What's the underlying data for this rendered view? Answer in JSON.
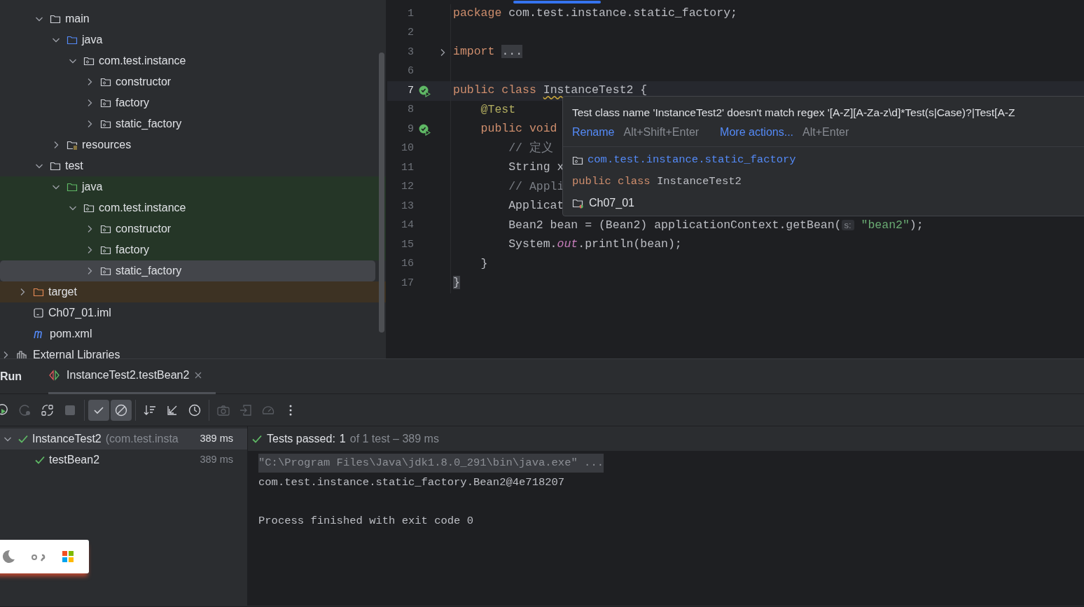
{
  "project_tree": [
    {
      "children": [
        {
          "children": [
            {
              "label": "main",
              "kind": "folder",
              "expanded": true,
              "selected": false,
              "children": [
                {
                  "label": "java",
                  "kind": "source-folder",
                  "expanded": true,
                  "selected": false,
                  "children": [
                    {
                      "label": "com.test.instance",
                      "kind": "package",
                      "expanded": true,
                      "selected": false,
                      "children": [
                        {
                          "label": "constructor",
                          "kind": "package",
                          "expanded": false,
                          "selected": false
                        },
                        {
                          "label": "factory",
                          "kind": "package",
                          "expanded": false,
                          "selected": false
                        },
                        {
                          "label": "static_factory",
                          "kind": "package",
                          "expanded": false,
                          "selected": false
                        }
                      ]
                    }
                  ]
                },
                {
                  "label": "resources",
                  "kind": "resources-folder",
                  "expanded": false,
                  "selected": false
                }
              ]
            },
            {
              "label": "test",
              "kind": "folder",
              "expanded": true,
              "selected": false,
              "children": [
                {
                  "label": "java",
                  "kind": "test-folder",
                  "expanded": true,
                  "selected": false,
                  "children": [
                    {
                      "label": "com.test.instance",
                      "kind": "package",
                      "expanded": true,
                      "selected": false,
                      "children": [
                        {
                          "label": "constructor",
                          "kind": "package",
                          "expanded": false,
                          "selected": false
                        },
                        {
                          "label": "factory",
                          "kind": "package",
                          "expanded": false,
                          "selected": false
                        },
                        {
                          "label": "static_factory",
                          "kind": "package",
                          "expanded": false,
                          "selected": true
                        }
                      ]
                    }
                  ]
                }
              ]
            }
          ]
        },
        {
          "label": "target",
          "kind": "excluded-folder",
          "expanded": false,
          "selected": false
        },
        {
          "label": "Ch07_01.iml",
          "kind": "module-file",
          "selected": false
        },
        {
          "label": "pom.xml",
          "kind": "maven-file",
          "selected": false
        }
      ]
    },
    {
      "label": "External Libraries",
      "kind": "library",
      "expanded": false,
      "selected": false
    }
  ],
  "editor": {
    "lines": [
      {
        "number": "1",
        "current": false,
        "runnable": false,
        "folded": false,
        "segments": [
          {
            "kind": "keyword",
            "text": "package"
          },
          {
            "kind": "plain",
            "text": " com.test.instance.static_factory;"
          }
        ]
      },
      {
        "number": "2",
        "current": false,
        "runnable": false,
        "folded": false
      },
      {
        "number": "3",
        "current": false,
        "runnable": false,
        "folded": true,
        "segments": [
          {
            "kind": "keyword",
            "text": "import"
          },
          {
            "kind": "fold",
            "text": "..."
          }
        ]
      },
      {
        "number": "6",
        "current": false,
        "runnable": false,
        "folded": false
      },
      {
        "number": "7",
        "current": true,
        "runnable": true,
        "folded": false,
        "segments": [
          {
            "kind": "keyword",
            "text": "public class "
          },
          {
            "kind": "warning",
            "text": "InstanceTest2"
          },
          {
            "kind": "plain",
            "text": " {"
          }
        ]
      },
      {
        "number": "8",
        "current": false,
        "runnable": false,
        "folded": false,
        "segments": [
          {
            "kind": "annotation",
            "text": "    @Test"
          }
        ]
      },
      {
        "number": "9",
        "current": false,
        "runnable": true,
        "folded": false,
        "segments": [
          {
            "kind": "keyword",
            "text": "    public void"
          }
        ]
      },
      {
        "number": "10",
        "current": false,
        "runnable": false,
        "folded": false,
        "segments": [
          {
            "kind": "comment",
            "text": "        // 定义"
          }
        ]
      },
      {
        "number": "11",
        "current": false,
        "runnable": false,
        "folded": false,
        "segments": [
          {
            "kind": "plain",
            "text": "        String x"
          }
        ]
      },
      {
        "number": "12",
        "current": false,
        "runnable": false,
        "folded": false,
        "segments": [
          {
            "kind": "comment",
            "text": "        // Appli"
          }
        ]
      },
      {
        "number": "13",
        "current": false,
        "runnable": false,
        "folded": false,
        "segments": [
          {
            "kind": "plain",
            "text": "        Applicat"
          }
        ]
      },
      {
        "number": "14",
        "current": false,
        "runnable": false,
        "folded": false,
        "segments": [
          {
            "kind": "plain",
            "text": "        Bean2 bean = (Bean2) applicationContext.getBean("
          },
          {
            "kind": "hint",
            "text": "s:"
          },
          {
            "kind": "string",
            "text": " \"bean2\""
          },
          {
            "kind": "plain",
            "text": ");"
          }
        ]
      },
      {
        "number": "15",
        "current": false,
        "runnable": false,
        "folded": false,
        "segments": [
          {
            "kind": "plain",
            "text": "        System."
          },
          {
            "kind": "field",
            "text": "out"
          },
          {
            "kind": "plain",
            "text": ".println(bean);"
          }
        ]
      },
      {
        "number": "16",
        "current": false,
        "runnable": false,
        "folded": false,
        "segments": [
          {
            "kind": "plain",
            "text": "    }"
          }
        ]
      },
      {
        "number": "17",
        "current": false,
        "runnable": false,
        "folded": false,
        "segments": [
          {
            "kind": "brace",
            "text": "}"
          }
        ]
      }
    ],
    "popup": {
      "message": "Test class name 'InstanceTest2' doesn't match regex '[A-Z][A-Za-z\\d]*Test(s|Case)?|Test[A-Z",
      "actions": [
        {
          "label": "Rename",
          "shortcut": "Alt+Shift+Enter"
        },
        {
          "label": "More actions...",
          "shortcut": "Alt+Enter"
        }
      ],
      "package": "com.test.instance.static_factory",
      "declaration": [
        {
          "kind": "keyword",
          "text": "public class"
        },
        {
          "kind": "plain",
          "text": " InstanceTest2"
        }
      ],
      "module": "Ch07_01"
    }
  },
  "run_panel": {
    "title": "Run",
    "tabs": [
      {
        "label": "InstanceTest2.testBean2",
        "selected": true
      }
    ],
    "toolbar": [
      [
        {
          "kind": "rerun",
          "on": false,
          "disabled": false
        },
        {
          "kind": "rerun-failed",
          "on": false,
          "disabled": true
        },
        {
          "kind": "toggle-auto",
          "on": false,
          "disabled": false
        },
        {
          "kind": "stop",
          "on": false,
          "disabled": true
        }
      ],
      [
        {
          "kind": "show-passed",
          "on": true,
          "disabled": false
        },
        {
          "kind": "show-ignored",
          "on": true,
          "disabled": false
        }
      ],
      [
        {
          "kind": "sort",
          "on": false,
          "disabled": false
        },
        {
          "kind": "import",
          "on": false,
          "disabled": false
        },
        {
          "kind": "history",
          "on": false,
          "disabled": false
        }
      ],
      [
        {
          "kind": "snapshot",
          "on": false,
          "disabled": true
        },
        {
          "kind": "export",
          "on": false,
          "disabled": true
        },
        {
          "kind": "coverage",
          "on": false,
          "disabled": true
        },
        {
          "kind": "more",
          "on": false,
          "disabled": false
        }
      ]
    ],
    "test_tree": [
      {
        "label": "InstanceTest2",
        "detail": "(com.test.insta",
        "duration": "389 ms",
        "passed": true,
        "expanded": true,
        "selected": true,
        "children": [
          {
            "label": "testBean2",
            "duration": "389 ms",
            "passed": true,
            "selected": false
          }
        ]
      }
    ],
    "status": {
      "passed": true,
      "label": "Tests passed:",
      "count": "1",
      "detail": "of 1 test – 389 ms"
    },
    "console": [
      {
        "kind": "command",
        "text": "\"C:\\Program Files\\Java\\jdk1.8.0_291\\bin\\java.exe\" ..."
      },
      {
        "kind": "output",
        "text": "com.test.instance.static_factory.Bean2@4e718207"
      },
      {
        "kind": "blank"
      },
      {
        "kind": "output",
        "text": "Process finished with exit code 0"
      }
    ]
  }
}
